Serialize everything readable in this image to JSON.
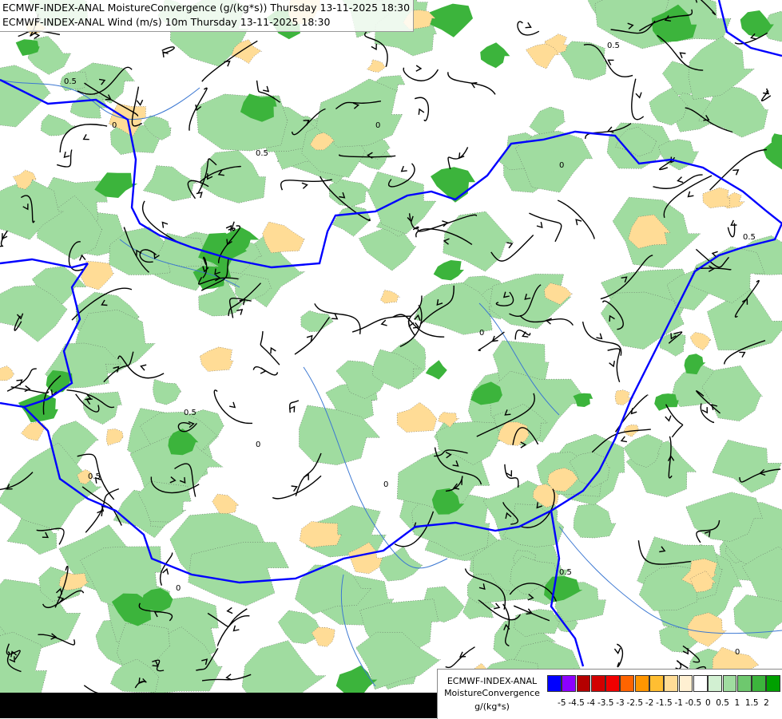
{
  "header": {
    "line1": "ECMWF-INDEX-ANAL MoistureConvergence (g/(kg*s)) Thursday 13-11-2025 18:30",
    "line2": "ECMWF-INDEX-ANAL Wind (m/s) 10m Thursday 13-11-2025 18:30"
  },
  "legend": {
    "title1": "ECMWF-INDEX-ANAL",
    "title2": "MoistureConvergence",
    "unit": "g/(kg*s)",
    "colors": [
      "#0000ff",
      "#8c00ff",
      "#b40000",
      "#d20000",
      "#f00000",
      "#ff6400",
      "#ff9600",
      "#ffbe32",
      "#ffdc96",
      "#fff0d2",
      "#ffffff",
      "#d2f0d2",
      "#a0dca0",
      "#6ec86e",
      "#3cb43c",
      "#00a000"
    ],
    "ticks": [
      "-5",
      "-4.5",
      "-4",
      "-3.5",
      "-3",
      "-2.5",
      "-2",
      "-1.5",
      "-1",
      "-0.5",
      "0",
      "0.5",
      "1",
      "1.5",
      "2"
    ]
  },
  "map": {
    "contour_labels": [
      "0.5",
      "0",
      "0.5",
      "0",
      "0.5",
      "0",
      "0.5",
      "0",
      "0.5",
      "0",
      "0.5",
      "0",
      "0.5",
      "0",
      "0.5",
      "0"
    ],
    "colors": {
      "border": "#0000ff",
      "river": "#3c78d2",
      "streamline": "#000000",
      "positive_fill": "#a0dca0",
      "strong_fill": "#3cb43c",
      "negative_fill": "#ffdc96"
    }
  }
}
